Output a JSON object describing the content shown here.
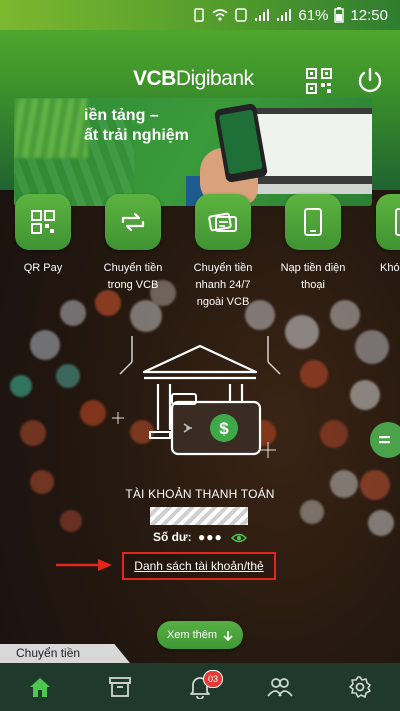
{
  "status_bar": {
    "battery": "61%",
    "time": "12:50"
  },
  "header": {
    "brand_bold": "VCB",
    "brand_light": "Digibank",
    "qr_icon": "qr-icon",
    "power_icon": "power-icon"
  },
  "banner": {
    "line1": "iền tảng –",
    "line2": "ất trải nghiệm"
  },
  "quick_actions": [
    {
      "label": "QR Pay",
      "icon": "qr-pay-icon"
    },
    {
      "label": "Chuyển tiền trong VCB",
      "icon": "transfer-icon"
    },
    {
      "label": "Chuyển tiền nhanh 24/7 ngoài VCB",
      "icon": "fast-transfer-icon"
    },
    {
      "label": "Nạp tiền điện thoại",
      "icon": "phone-topup-icon"
    },
    {
      "label": "Khó",
      "icon": "more-icon"
    }
  ],
  "account": {
    "title": "TÀI KHOẢN THANH TOÁN",
    "balance_label": "Số dư:",
    "balance_mask": "●●●",
    "list_link": "Danh sách tài khoản/thẻ"
  },
  "see_more": {
    "label": "Xem thêm"
  },
  "section": {
    "label": "Chuyển tiền"
  },
  "bottom_nav": {
    "notification_count": "03"
  },
  "colors": {
    "brand_green": "#3d922b",
    "highlight_red": "#e2261c",
    "nav_bg": "#1f3a2c"
  }
}
